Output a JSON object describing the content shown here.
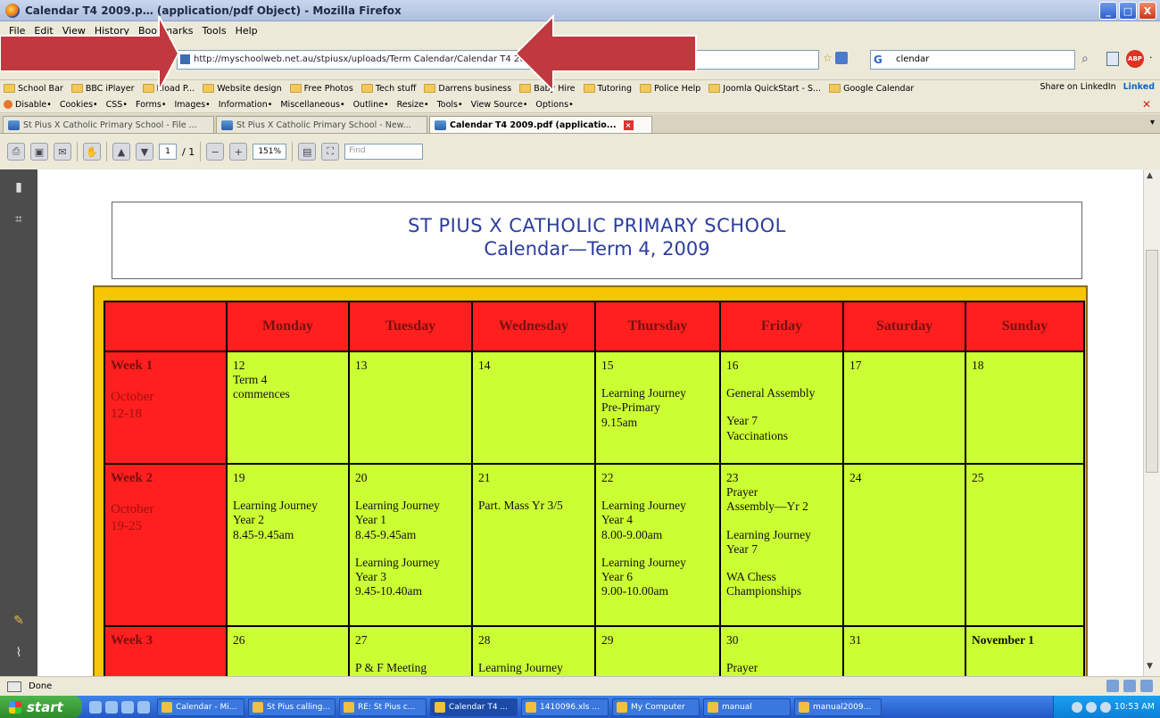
{
  "window": {
    "title": "Calendar T4 2009.p… (application/pdf Object) - Mozilla Firefox",
    "minimize": "_",
    "maximize": "□",
    "close": "X"
  },
  "menu": [
    "File",
    "Edit",
    "View",
    "History",
    "Bookmarks",
    "Tools",
    "Help"
  ],
  "navbar": {
    "url": "http://myschoolweb.net.au/stpiusx/uploads/Term Calendar/Calendar T4 2009.pdf",
    "search_value": "clendar"
  },
  "bookmarks": [
    "School Bar",
    "BBC iPlayer",
    "Eload P...",
    "Website design",
    "Free Photos",
    "Tech stuff",
    "Darrens business",
    "Baby Hire",
    "Tutoring",
    "Police Help",
    "Joomla QuickStart - S...",
    "Google Calendar"
  ],
  "bookmarks_right": {
    "share": "Share on LinkedIn",
    "brand": "Linked"
  },
  "devbar": [
    "Disable•",
    "Cookies•",
    "CSS•",
    "Forms•",
    "Images•",
    "Information•",
    "Miscellaneous•",
    "Outline•",
    "Resize•",
    "Tools•",
    "View Source•",
    "Options•"
  ],
  "tabs": [
    {
      "label": "St Pius X Catholic Primary School - File ..."
    },
    {
      "label": "St Pius X Catholic Primary School - New..."
    },
    {
      "label": "Calendar T4 2009.pdf (applicatio..."
    }
  ],
  "pdf_toolbar": {
    "page": "1",
    "page_total": "/ 1",
    "zoom": "151%",
    "find_placeholder": "Find"
  },
  "document": {
    "school": "ST PIUS X CATHOLIC PRIMARY SCHOOL",
    "title": "Calendar—Term 4, 2009",
    "days": [
      "Monday",
      "Tuesday",
      "Wednesday",
      "Thursday",
      "Friday",
      "Saturday",
      "Sunday"
    ],
    "weeks": [
      {
        "label": "Week 1",
        "dates": [
          "October",
          "12-18"
        ],
        "cells": [
          [
            "12",
            "Term 4",
            "commences"
          ],
          [
            "13"
          ],
          [
            "14"
          ],
          [
            "15",
            "",
            "Learning Journey",
            "Pre-Primary",
            "9.15am"
          ],
          [
            "16",
            "",
            "General Assembly",
            "",
            "Year 7",
            "Vaccinations"
          ],
          [
            "17"
          ],
          [
            "18"
          ]
        ]
      },
      {
        "label": "Week 2",
        "dates": [
          "October",
          "19-25"
        ],
        "cells": [
          [
            "19",
            "",
            "Learning Journey",
            "Year 2",
            "8.45-9.45am"
          ],
          [
            "20",
            "",
            "Learning Journey",
            "Year 1",
            "8.45-9.45am",
            "",
            "Learning Journey",
            "Year 3",
            "9.45-10.40am"
          ],
          [
            "21",
            "",
            "Part. Mass Yr 3/5"
          ],
          [
            "22",
            "",
            "Learning Journey",
            "Year  4",
            "8.00-9.00am",
            "",
            "Learning Journey",
            "Year 6",
            "9.00-10.00am"
          ],
          [
            "23",
            "Prayer",
            "Assembly—Yr 2",
            "",
            "Learning Journey",
            "Year 7",
            "",
            "WA Chess",
            "Championships"
          ],
          [
            "24"
          ],
          [
            "25"
          ]
        ]
      },
      {
        "label": "Week 3",
        "dates": [],
        "cells": [
          [
            "26"
          ],
          [
            "27",
            "",
            "P & F Meeting"
          ],
          [
            "28",
            "",
            "Learning Journey"
          ],
          [
            "29"
          ],
          [
            "30",
            "",
            "Prayer"
          ],
          [
            "31"
          ],
          [
            "November 1"
          ]
        ]
      }
    ]
  },
  "status": "Done",
  "taskbar": {
    "start": "start",
    "tasks": [
      "Calendar - Mi...",
      "St Pius calling...",
      "RE: St Pius c...",
      "Calendar T4 ...",
      "1410096.xls ...",
      "My Computer",
      "manual",
      "manual2009..."
    ],
    "clock": "10:53 AM"
  },
  "colors": {
    "header_red": "#ff1f1f",
    "cell_green": "#cbff33",
    "frame_gold": "#f7c600",
    "title_blue": "#2c3e9e",
    "arrow_red": "#c0393f"
  }
}
